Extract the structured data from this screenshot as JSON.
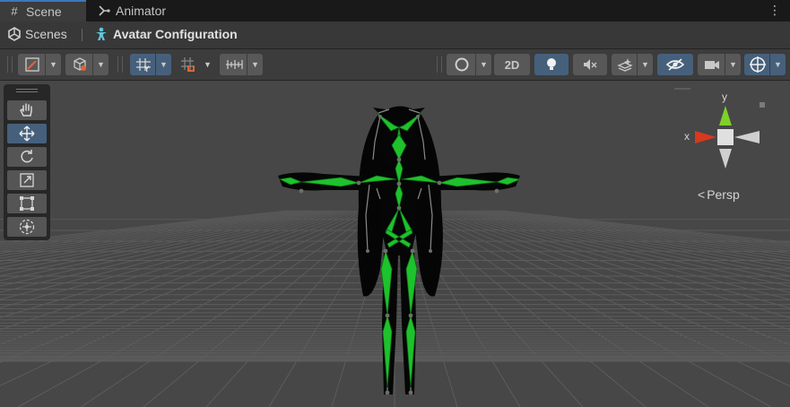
{
  "tabs": [
    {
      "label": "Scene",
      "icon": "grid-icon",
      "active": true
    },
    {
      "label": "Animator",
      "icon": "animator-icon",
      "active": false
    }
  ],
  "breadcrumb": {
    "root": "Scenes",
    "current": "Avatar Configuration"
  },
  "toolbar": {
    "two_d_label": "2D"
  },
  "tools": [
    "hand-tool",
    "move-tool",
    "rotate-tool",
    "scale-tool",
    "rect-tool",
    "transform-tool"
  ],
  "gizmo": {
    "y_label": "y",
    "x_label": "x",
    "projection": "Persp"
  },
  "colors": {
    "accent": "#46607c",
    "bone": "#1ec22c",
    "bone_outline": "#888888",
    "x_axis": "#d8391c",
    "y_axis": "#7fd02a",
    "z_axis": "#3a6fe0"
  }
}
